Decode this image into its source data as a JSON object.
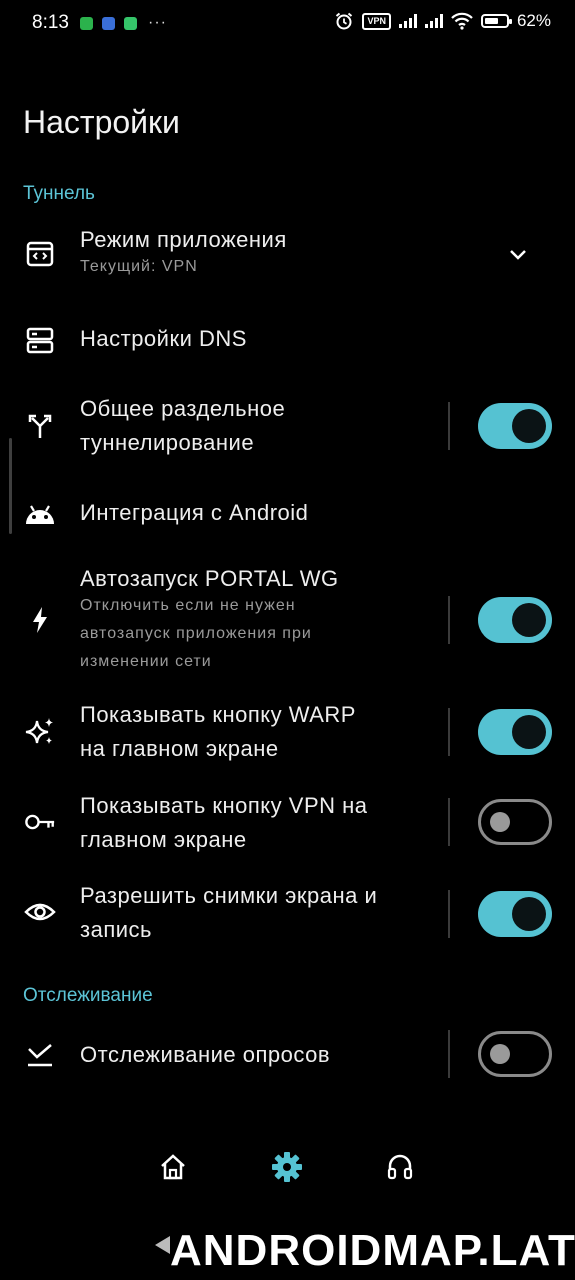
{
  "status_bar": {
    "time": "8:13",
    "dots": "···",
    "vpn": "VPN",
    "battery": "62%"
  },
  "header": {
    "title": "Настройки"
  },
  "sections": {
    "tunnel": "Туннель",
    "tracking": "Отслеживание"
  },
  "settings": {
    "app_mode": {
      "title": "Режим приложения",
      "subtitle": "Текущий: VPN"
    },
    "dns": {
      "title": "Настройки DNS"
    },
    "split": {
      "title_line1": "Общее раздельное",
      "title_line2": "туннелирование",
      "enabled": true
    },
    "android": {
      "title": "Интеграция с Android"
    },
    "autostart": {
      "title": "Автозапуск PORTAL WG",
      "sub_line1": "Отключить если не нужен",
      "sub_line2": "автозапуск приложения при",
      "sub_line3": "изменении сети",
      "enabled": true
    },
    "warp": {
      "title_line1": "Показывать кнопку WARP",
      "title_line2": "на главном экране",
      "enabled": true
    },
    "vpn_btn": {
      "title_line1": "Показывать кнопку VPN на",
      "title_line2": "главном экране",
      "enabled": false
    },
    "screenshots": {
      "title_line1": "Разрешить снимки экрана и",
      "title_line2": "запись",
      "enabled": true
    },
    "polls": {
      "title": "Отслеживание опросов",
      "enabled": false
    }
  },
  "bottom_nav": {
    "items": [
      "home-icon",
      "gear-icon",
      "headset-icon"
    ],
    "active": "gear-icon"
  },
  "colors": {
    "accent": "#55c2d2",
    "background": "#000000"
  },
  "watermark": "ANDROIDMAP.LAT"
}
